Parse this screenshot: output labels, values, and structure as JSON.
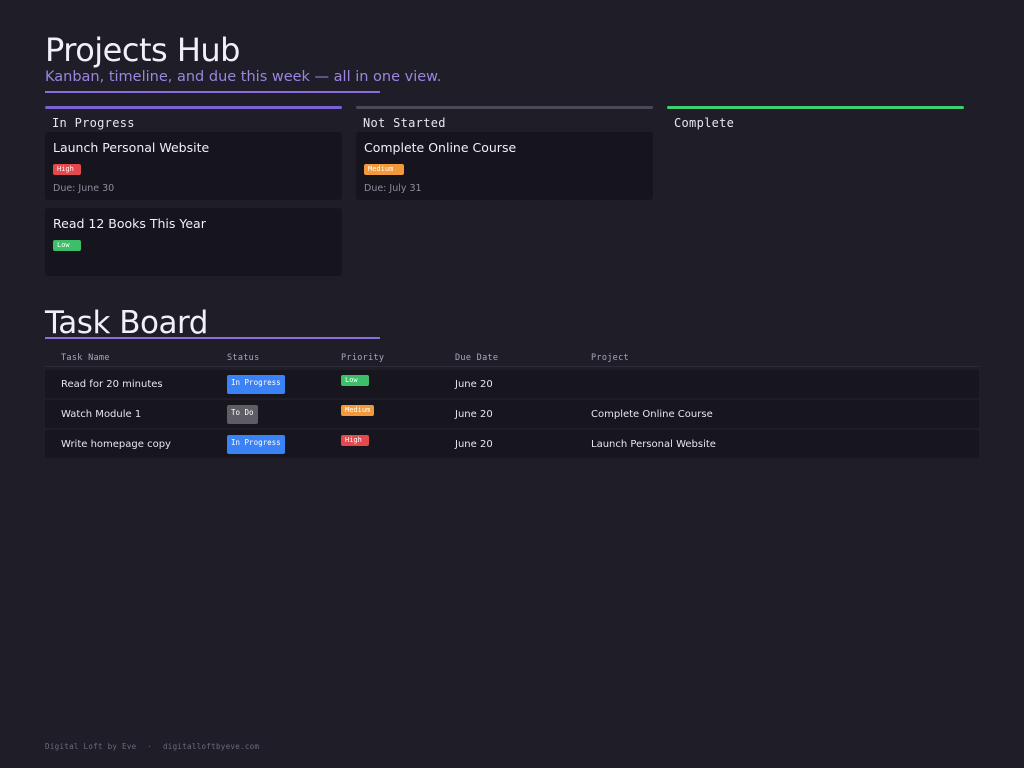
{
  "header": {
    "title": "Projects Hub",
    "subtitle": "Kanban, timeline, and due this week — all in one view."
  },
  "kanban": {
    "columns": [
      {
        "title": "In Progress",
        "color": "#7b61d6",
        "cards": [
          {
            "title": "Launch Personal Website",
            "priority": "High",
            "due": "Due: June 30"
          },
          {
            "title": "Read 12 Books This Year",
            "priority": "Low",
            "due": ""
          }
        ]
      },
      {
        "title": "Not Started",
        "color": "#4a4955",
        "cards": [
          {
            "title": "Complete Online Course",
            "priority": "Medium",
            "due": "Due: July 31"
          }
        ]
      },
      {
        "title": "Complete",
        "color": "#3ecf6e",
        "cards": []
      }
    ]
  },
  "task_board": {
    "title": "Task Board",
    "columns": [
      "Task Name",
      "Status",
      "Priority",
      "Due Date",
      "Project"
    ],
    "rows": [
      {
        "task": "Read for 20 minutes",
        "status": "In Progress",
        "priority": "Low",
        "due": "June 20",
        "project": ""
      },
      {
        "task": "Watch Module 1",
        "status": "To Do",
        "priority": "Medium",
        "due": "June 20",
        "project": "Complete Online Course"
      },
      {
        "task": "Write homepage copy",
        "status": "In Progress",
        "priority": "High",
        "due": "June 20",
        "project": "Launch Personal Website"
      }
    ]
  },
  "colors": {
    "accent": "#8a6fdc",
    "high": "#e5484d",
    "medium": "#f29a3b",
    "low": "#3cbf68",
    "in_progress": "#3b82f6",
    "to_do": "#5e5d66"
  },
  "footer": {
    "brand": "Digital Loft by Eve",
    "separator": "·",
    "url": "digitalloftbyeve.com"
  }
}
